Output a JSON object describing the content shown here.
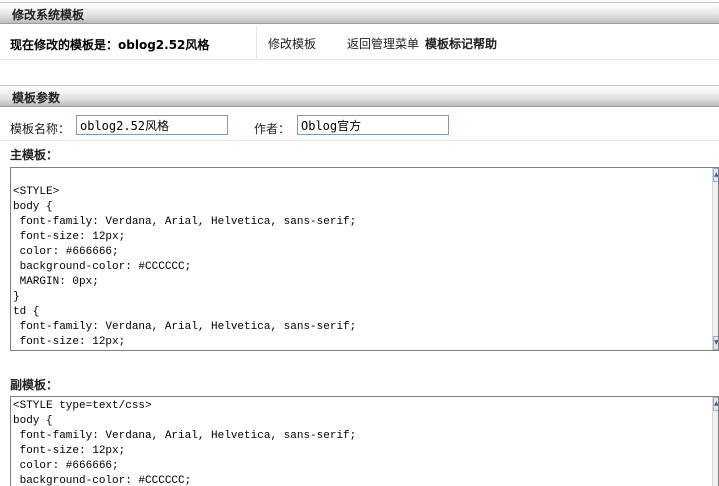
{
  "system_section": {
    "title": "修改系统模板",
    "current_template_label": "现在修改的模板是：oblog2.52风格",
    "links": {
      "edit_template": "修改模板",
      "back_to_menu": "返回管理菜单",
      "template_help": "模板标记帮助"
    }
  },
  "params_section": {
    "title": "模板参数",
    "name_label": "模板名称：",
    "name_value": "oblog2.52风格",
    "author_label": "作者：",
    "author_value": "Oblog官方"
  },
  "main_template": {
    "label": "主模板：",
    "code": "\n<STYLE>\nbody {\n font-family: Verdana, Arial, Helvetica, sans-serif;\n font-size: 12px;\n color: #666666;\n background-color: #CCCCCC;\n MARGIN: 0px;\n}\ntd {\n font-family: Verdana, Arial, Helvetica, sans-serif;\n font-size: 12px;"
  },
  "sub_template": {
    "label": "副模板：",
    "code": "<STYLE type=text/css>\nbody {\n font-family: Verdana, Arial, Helvetica, sans-serif;\n font-size: 12px;\n color: #666666;\n background-color: #CCCCCC;"
  },
  "icons": {
    "scroll_up": "▲",
    "scroll_down": "▼"
  }
}
